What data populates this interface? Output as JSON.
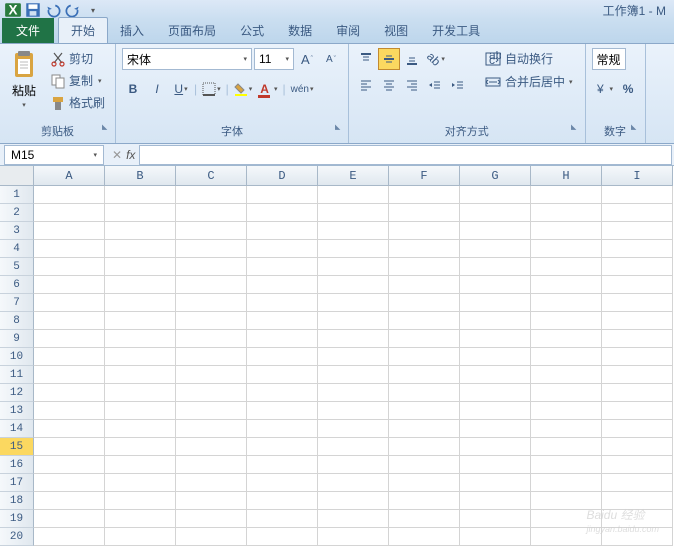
{
  "window": {
    "title": "工作簿1 - M"
  },
  "tabs": {
    "file": "文件",
    "items": [
      "开始",
      "插入",
      "页面布局",
      "公式",
      "数据",
      "审阅",
      "视图",
      "开发工具"
    ],
    "active": 0
  },
  "ribbon": {
    "clipboard": {
      "paste": "粘贴",
      "cut": "剪切",
      "copy": "复制",
      "format_painter": "格式刷",
      "label": "剪贴板"
    },
    "font": {
      "name": "宋体",
      "size": "11",
      "label": "字体"
    },
    "alignment": {
      "wrap": "自动换行",
      "merge": "合并后居中",
      "label": "对齐方式"
    },
    "number": {
      "format": "常规",
      "label": "数字"
    }
  },
  "namebox": {
    "ref": "M15",
    "fx": "fx"
  },
  "grid": {
    "cols": [
      "A",
      "B",
      "C",
      "D",
      "E",
      "F",
      "G",
      "H",
      "I"
    ],
    "rows": [
      "1",
      "2",
      "3",
      "4",
      "5",
      "6",
      "7",
      "8",
      "9",
      "10",
      "11",
      "12",
      "13",
      "14",
      "15",
      "16",
      "17",
      "18",
      "19",
      "20"
    ],
    "selected_row": 15
  },
  "watermark": {
    "main": "Baidu 经验",
    "sub": "jingyan.baidu.com"
  }
}
